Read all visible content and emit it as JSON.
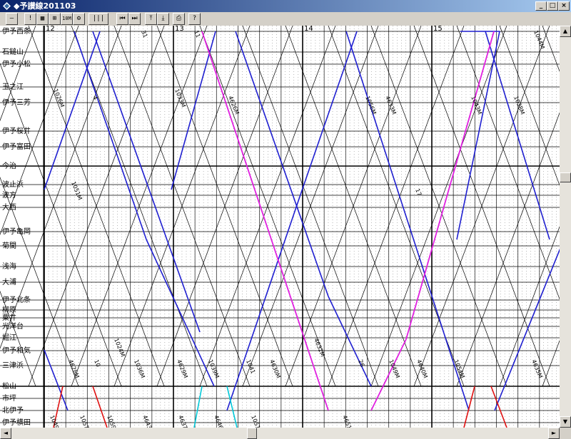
{
  "window": {
    "title": "◆予讃線201103",
    "minimize_glyph": "_",
    "maximize_glyph": "□",
    "close_glyph": "×"
  },
  "toolbar": {
    "buttons": [
      {
        "name": "minus",
        "glyph": "—"
      },
      {
        "name": "alert",
        "glyph": "!"
      },
      {
        "name": "grid",
        "glyph": "▦"
      },
      {
        "name": "chart",
        "glyph": "⊞"
      },
      {
        "name": "zoom",
        "glyph": "10M"
      },
      {
        "name": "settings",
        "glyph": "⚙"
      },
      {
        "name": "columns",
        "glyph": "|||"
      },
      {
        "name": "skip-back",
        "glyph": "⏮"
      },
      {
        "name": "skip-forward",
        "glyph": "⏭"
      },
      {
        "name": "top",
        "glyph": "⤒"
      },
      {
        "name": "bottom",
        "glyph": "⤓"
      },
      {
        "name": "print",
        "glyph": "⎙"
      },
      {
        "name": "help",
        "glyph": "?"
      }
    ]
  },
  "diagram": {
    "hours": [
      "12",
      "13",
      "14",
      "15"
    ],
    "stations": [
      "伊予西条",
      "石鎚山",
      "伊予小松",
      "玉之江",
      "伊予三芳",
      "伊予桜井",
      "伊予富田",
      "今治",
      "波止浜",
      "波方",
      "大西",
      "伊予亀岡",
      "菊間",
      "浅海",
      "大浦",
      "伊予北条",
      "柳原",
      "粟井",
      "光洋台",
      "堀江",
      "伊予和気",
      "三津浜",
      "松山",
      "市坪",
      "北伊予",
      "伊予横田"
    ],
    "train_numbers": [
      "1026M",
      "4",
      "31",
      "1033M",
      "4626M",
      "1051M",
      "4628M",
      "10",
      "1024M",
      "1036M",
      "4629M",
      "11",
      "1039M",
      "1041",
      "4630M",
      "4632M",
      "1056M",
      "4633M",
      "17",
      "1054M",
      "1043M",
      "1038M",
      "1044M",
      "4635M",
      "26",
      "1049M",
      "4640M",
      "1049",
      "1057M",
      "1059M",
      "4643M",
      "4637M",
      "4646M",
      "1051",
      "4651M"
    ],
    "line_colors": {
      "limited-express": "#1f1fd0",
      "limited-express-alt": "#e020e0",
      "local": "#000000",
      "red-train": "#e01010",
      "cyan-train": "#00c8d8"
    }
  },
  "scrollbars": {
    "up": "▲",
    "down": "▼",
    "left": "◄",
    "right": "►"
  }
}
